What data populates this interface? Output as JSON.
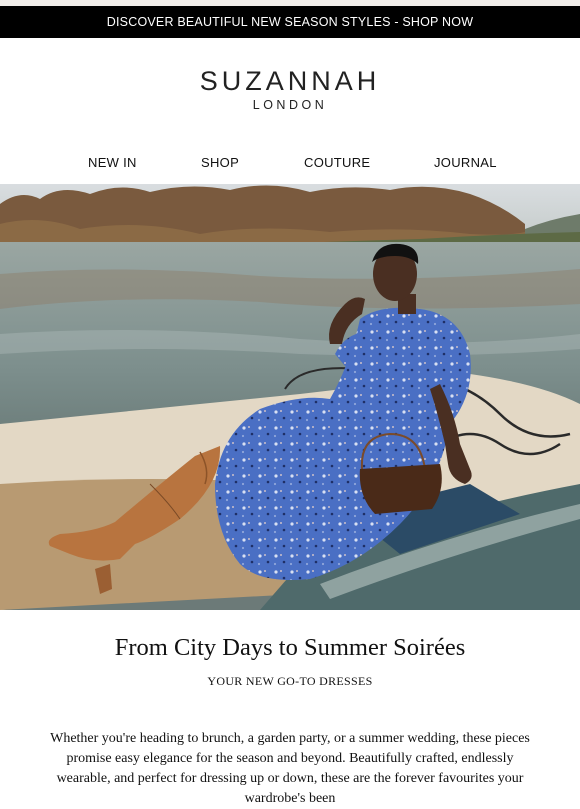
{
  "promo_banner": {
    "text": "DISCOVER BEAUTIFUL NEW SEASON STYLES - SHOP NOW"
  },
  "brand": {
    "name": "SUZANNAH",
    "location": "LONDON"
  },
  "nav": {
    "items": [
      {
        "label": "NEW IN"
      },
      {
        "label": "SHOP"
      },
      {
        "label": "COUTURE"
      },
      {
        "label": "JOURNAL"
      }
    ]
  },
  "hero": {
    "dress_color": "#4a6fc4",
    "water_color": "#7d8f8d"
  },
  "article": {
    "headline": "From City Days to Summer Soirées",
    "subheadline": "YOUR NEW GO-TO DRESSES",
    "body": "Whether you're heading to brunch, a garden party, or a summer wedding, these pieces promise easy elegance for the season and beyond. Beautifully crafted, endlessly wearable, and perfect for dressing up or down, these are the forever favourites your wardrobe's been"
  }
}
